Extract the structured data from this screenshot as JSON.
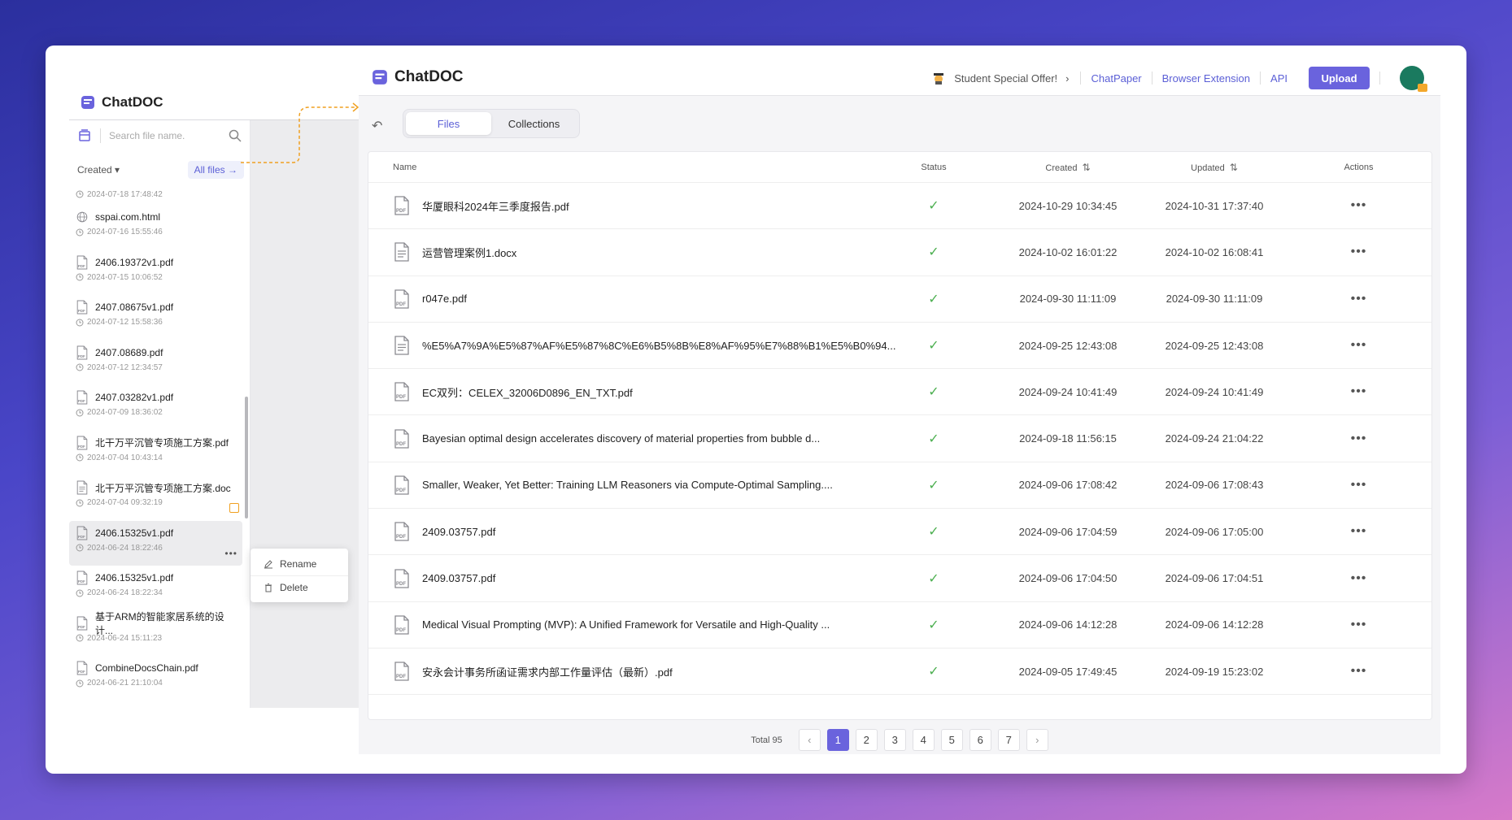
{
  "brand": "ChatDOC",
  "topnav": {
    "offer": "Student Special Offer!",
    "links": [
      "ChatPaper",
      "Browser Extension",
      "API"
    ],
    "upload": "Upload"
  },
  "tabs": [
    {
      "label": "Files",
      "active": true
    },
    {
      "label": "Collections",
      "active": false
    }
  ],
  "table": {
    "headers": {
      "name": "Name",
      "status": "Status",
      "created": "Created",
      "updated": "Updated",
      "actions": "Actions"
    },
    "rows": [
      {
        "name": "华厦眼科2024年三季度报告.pdf",
        "type": "pdf",
        "created": "2024-10-29 10:34:45",
        "updated": "2024-10-31 17:37:40"
      },
      {
        "name": "运营管理案例1.docx",
        "type": "doc",
        "created": "2024-10-02 16:01:22",
        "updated": "2024-10-02 16:08:41"
      },
      {
        "name": "r047e.pdf",
        "type": "pdf",
        "created": "2024-09-30 11:11:09",
        "updated": "2024-09-30 11:11:09"
      },
      {
        "name": "%E5%A7%9A%E5%87%AF%E5%87%8C%E6%B5%8B%E8%AF%95%E7%88%B1%E5%B0%94...",
        "type": "doc",
        "created": "2024-09-25 12:43:08",
        "updated": "2024-09-25 12:43:08"
      },
      {
        "name": "EC双列：CELEX_32006D0896_EN_TXT.pdf",
        "type": "pdf",
        "created": "2024-09-24 10:41:49",
        "updated": "2024-09-24 10:41:49"
      },
      {
        "name": "Bayesian optimal design accelerates discovery of material properties from bubble d...",
        "type": "pdf",
        "created": "2024-09-18 11:56:15",
        "updated": "2024-09-24 21:04:22"
      },
      {
        "name": "Smaller, Weaker, Yet Better: Training LLM Reasoners via Compute-Optimal Sampling....",
        "type": "pdf",
        "created": "2024-09-06 17:08:42",
        "updated": "2024-09-06 17:08:43"
      },
      {
        "name": "2409.03757.pdf",
        "type": "pdf",
        "created": "2024-09-06 17:04:59",
        "updated": "2024-09-06 17:05:00"
      },
      {
        "name": "2409.03757.pdf",
        "type": "pdf",
        "created": "2024-09-06 17:04:50",
        "updated": "2024-09-06 17:04:51"
      },
      {
        "name": "Medical Visual Prompting (MVP): A Unified Framework for Versatile and High-Quality ...",
        "type": "pdf",
        "created": "2024-09-06 14:12:28",
        "updated": "2024-09-06 14:12:28"
      },
      {
        "name": "安永会计事务所函证需求内部工作量评估（最新）.pdf",
        "type": "pdf",
        "created": "2024-09-05 17:49:45",
        "updated": "2024-09-19 15:23:02"
      }
    ]
  },
  "pagination": {
    "total": "Total 95",
    "pages": [
      "1",
      "2",
      "3",
      "4",
      "5",
      "6",
      "7"
    ],
    "current": "1"
  },
  "sidebar": {
    "search_placeholder": "Search file name.",
    "sort_label": "Created",
    "all_files": "All files",
    "first_time": "2024-07-18 17:48:42",
    "items": [
      {
        "name": "sspai.com.html",
        "type": "web",
        "time": "2024-07-16 15:55:46"
      },
      {
        "name": "2406.19372v1.pdf",
        "type": "pdf",
        "time": "2024-07-15 10:06:52"
      },
      {
        "name": "2407.08675v1.pdf",
        "type": "pdf",
        "time": "2024-07-12 15:58:36"
      },
      {
        "name": "2407.08689.pdf",
        "type": "pdf",
        "time": "2024-07-12 12:34:57"
      },
      {
        "name": "2407.03282v1.pdf",
        "type": "pdf",
        "time": "2024-07-09 18:36:02"
      },
      {
        "name": "北干万平沉管专项施工方案.pdf",
        "type": "pdf",
        "time": "2024-07-04 10:43:14"
      },
      {
        "name": "北干万平沉管专项施工方案.doc",
        "type": "doc",
        "time": "2024-07-04 09:32:19",
        "warn": true
      },
      {
        "name": "2406.15325v1.pdf",
        "type": "pdf",
        "time": "2024-06-24 18:22:46",
        "active": true
      },
      {
        "name": "2406.15325v1.pdf",
        "type": "pdf",
        "time": "2024-06-24 18:22:34"
      },
      {
        "name": "基于ARM的智能家居系统的设计...",
        "type": "pdf",
        "time": "2024-06-24 15:11:23"
      },
      {
        "name": "CombineDocsChain.pdf",
        "type": "pdf",
        "time": "2024-06-21 21:10:04"
      }
    ],
    "context_menu": [
      "Rename",
      "Delete"
    ]
  },
  "colors": {
    "accent": "#6a63dd",
    "link": "#5b5fd6",
    "success": "#4caf50",
    "warning": "#f0a020"
  }
}
